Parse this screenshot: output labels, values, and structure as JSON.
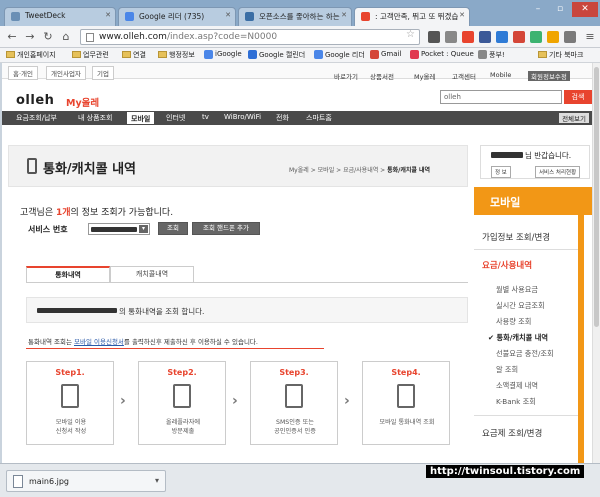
{
  "browser": {
    "tabs": [
      {
        "title": "TweetDeck",
        "active": false
      },
      {
        "title": "Google 리더 (735)",
        "active": false
      },
      {
        "title": "오픈소스를 좋아하는 하는",
        "active": false
      },
      {
        "title": ": 고객만족, 뛰고 또 뛰겠습",
        "active": true
      }
    ],
    "url_host": "www.olleh.com",
    "url_path": "/index.asp?code=N0000",
    "bookmarks": [
      "개인홈페이지",
      "업무관련",
      "연결",
      "행정정보",
      "iGoogle",
      "Google 캘린더",
      "Google 리더",
      "Gmail",
      "Pocket : Queue",
      "풍부!",
      "기타 북마크"
    ]
  },
  "site": {
    "top_tabs": [
      "홈·개인",
      "개인사업자",
      "기업"
    ],
    "util_links": [
      "바로가기",
      "상품서전",
      "My올레",
      "고객센터",
      "Mobile",
      "회원정보수정"
    ],
    "logo": "olleh",
    "brand": "My올레",
    "search_placeholder": "olleh",
    "search_button": "검색",
    "gnb": [
      "요금조회/납부",
      "내 상품조회",
      "모바일",
      "인터넷",
      "tv",
      "WiBro/WiFi",
      "전화",
      "스마트홈"
    ],
    "gnb_all": "전체보기"
  },
  "content": {
    "title": "통화/캐치콜 내역",
    "breadcrumb": {
      "items": [
        "My올레",
        "모바일",
        "요금/사용내역"
      ],
      "current": "통화/캐치콜 내역",
      "sep": ">"
    },
    "notice_prefix": "고객님은 ",
    "notice_count": "1개",
    "notice_suffix": "의 정보 조회가 가능합니다.",
    "service_label": "서비스 번호",
    "btn_lookup": "조회",
    "btn_lookup_other": "조회 핸드폰 추가",
    "subtabs": [
      "통화내역",
      "캐치콜내역"
    ],
    "info_text": "의 통화내역을 조회 합니다.",
    "guide_prefix": "통화내역 조회는 ",
    "guide_link": "모바일 이용신청서",
    "guide_suffix": "를 출력하신후 제출하신 후 이용하실 수 있습니다.",
    "steps": [
      {
        "label": "Step1.",
        "desc1": "모바일 이용",
        "desc2": "신청서 작성"
      },
      {
        "label": "Step2.",
        "desc1": "올레플라자에",
        "desc2": "방문제출"
      },
      {
        "label": "Step3.",
        "desc1": "SMS인증 또는",
        "desc2": "공인인증서 인증"
      },
      {
        "label": "Step4.",
        "desc1": "모바일 통화내역 조회",
        "desc2": ""
      }
    ]
  },
  "sidebar": {
    "greeting": "님 반갑습니다.",
    "btn_info": "정 보",
    "btn_change": "서비스 처리현황",
    "section_title": "모바일",
    "sec1": "가입정보 조회/변경",
    "sec2": "요금/사용내역",
    "items": [
      "월별 사용요금",
      "실시간 요금조회",
      "사용량 조회",
      "통화/캐치콜 내역",
      "선불요금 충전/조회",
      "알 조회",
      "소액결제 내역",
      "K-Bank 조회"
    ],
    "active_index": 3,
    "sec3": "요금제 조회/변경"
  },
  "shelf": {
    "file": "main6.jpg",
    "watermark": "http://twinsoul.tistory.com"
  }
}
